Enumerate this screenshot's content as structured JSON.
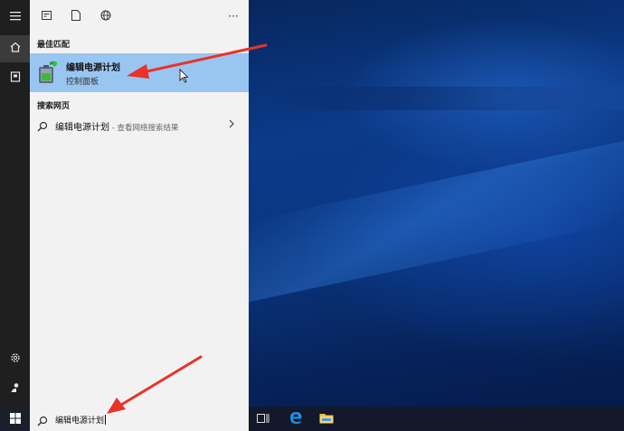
{
  "panel": {
    "best_match_label": "最佳匹配",
    "best_match": {
      "title": "编辑电源计划",
      "subtitle": "控制面板"
    },
    "web_label": "搜索网页",
    "web_result": {
      "text": "编辑电源计划",
      "sub": " - 查看网络搜索结果"
    }
  },
  "topbar": {
    "more_label": "···"
  },
  "search": {
    "value": "编辑电源计划"
  },
  "icons": {
    "rail": [
      "hamburger-icon",
      "home-icon",
      "documents-icon",
      "settings-icon",
      "user-icon"
    ],
    "topbar": [
      "apps-icon",
      "document-icon",
      "globe-icon",
      "more-icon"
    ],
    "taskbar": [
      "windows-icon",
      "task-view-icon",
      "edge-icon",
      "file-explorer-icon"
    ]
  },
  "colors": {
    "accent": "#99c6f0",
    "panel_bg": "#f2f2f2",
    "rail_bg": "#1f1f1f",
    "taskbar_bg": "#13192a",
    "annotation_arrow": "#e8322b"
  }
}
